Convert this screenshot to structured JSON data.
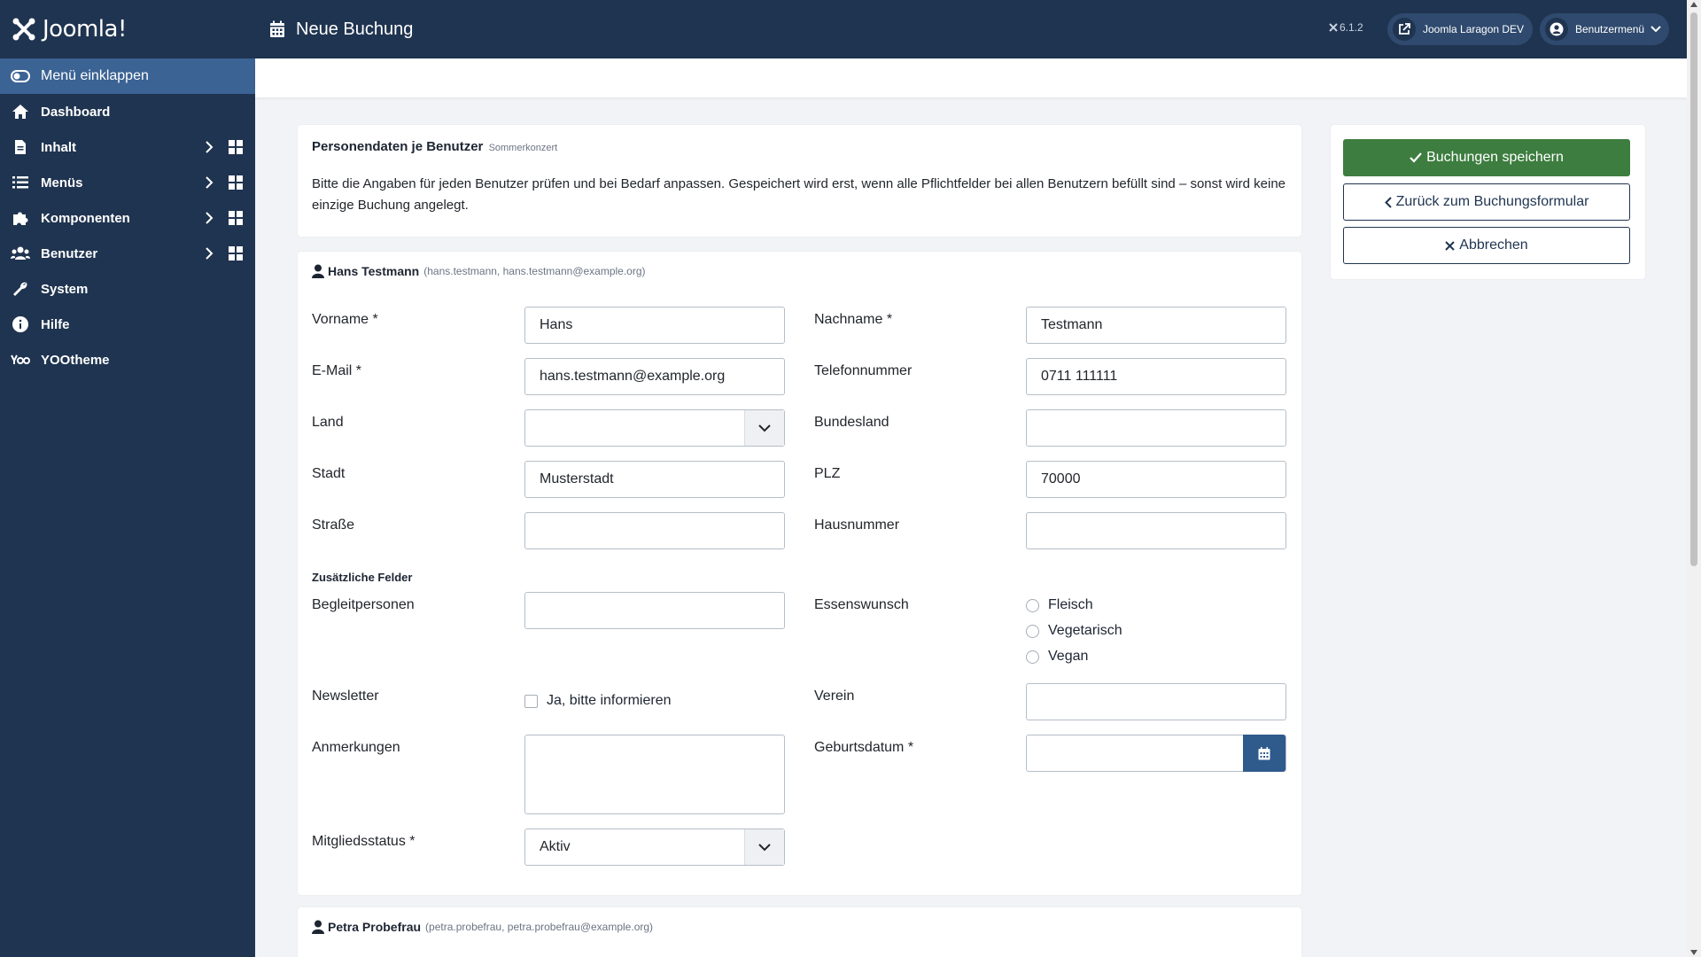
{
  "sidebar": {
    "logo": "Joomla!",
    "collapse_label": "Menü einklappen",
    "items": [
      {
        "label": "Dashboard",
        "icon": "home-icon"
      },
      {
        "label": "Inhalt",
        "icon": "file-icon"
      },
      {
        "label": "Menüs",
        "icon": "list-icon"
      },
      {
        "label": "Komponenten",
        "icon": "puzzle-icon"
      },
      {
        "label": "Benutzer",
        "icon": "users-icon"
      },
      {
        "label": "System",
        "icon": "wrench-icon"
      },
      {
        "label": "Hilfe",
        "icon": "info-icon"
      },
      {
        "label": "YOOtheme",
        "icon": "yoo-icon"
      }
    ]
  },
  "header": {
    "title": "Neue Buchung",
    "version": "6.1.2",
    "site_link": "Joomla Laragon DEV",
    "user_menu": "Benutzermenü"
  },
  "info": {
    "title": "Personendaten je Benutzer",
    "subtitle": "Sommerkonzert",
    "text": "Bitte die Angaben für jeden Benutzer prüfen und bei Bedarf anpassen. Gespeichert wird erst, wenn alle Pflichtfelder bei allen Benutzern befüllt sind – sonst wird keine einzige Buchung angelegt."
  },
  "person1": {
    "name": "Hans Testmann",
    "meta": "(hans.testmann, hans.testmann@example.org)",
    "labels": {
      "vorname": "Vorname *",
      "nachname": "Nachname *",
      "email": "E-Mail *",
      "telefon": "Telefonnummer",
      "land": "Land",
      "bundesland": "Bundesland",
      "stadt": "Stadt",
      "plz": "PLZ",
      "strasse": "Straße",
      "hausnummer": "Hausnummer",
      "zusatz": "Zusätzliche Felder",
      "begleit": "Begleitpersonen",
      "essen": "Essenswunsch",
      "newsletter": "Newsletter",
      "verein": "Verein",
      "anmerkungen": "Anmerkungen",
      "geburtsdatum": "Geburtsdatum *",
      "mitglied": "Mitgliedsstatus *"
    },
    "values": {
      "vorname": "Hans",
      "nachname": "Testmann",
      "email": "hans.testmann@example.org",
      "telefon": "0711 111111",
      "land": "",
      "bundesland": "",
      "stadt": "Musterstadt",
      "plz": "70000",
      "strasse": "",
      "hausnummer": "",
      "begleit": "",
      "verein": "",
      "anmerkungen": "",
      "geburtsdatum": "",
      "mitglied": "Aktiv"
    },
    "essen_options": [
      "Fleisch",
      "Vegetarisch",
      "Vegan"
    ],
    "newsletter_option": "Ja, bitte informieren"
  },
  "person2": {
    "name": "Petra Probefrau",
    "meta": "(petra.probefrau, petra.probefrau@example.org)"
  },
  "actions": {
    "save": "Buchungen speichern",
    "back": "Zurück zum Buchungsformular",
    "cancel": "Abbrechen"
  },
  "colors": {
    "sidebar": "#1f3450",
    "accent": "#3b6394",
    "save": "#3d7d3f"
  }
}
